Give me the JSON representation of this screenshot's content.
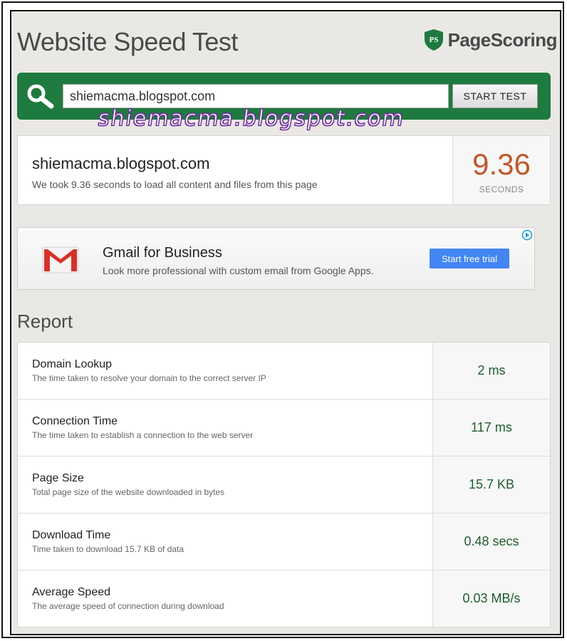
{
  "header": {
    "title": "Website Speed Test",
    "brand": "PageScoring",
    "brand_badge": "PS"
  },
  "search": {
    "value": "shiemacma.blogspot.com",
    "button_label": "START TEST"
  },
  "watermark": "shiemacma.blogspot.com",
  "result": {
    "domain": "shiemacma.blogspot.com",
    "description": "We took 9.36 seconds to load all content and files from this page",
    "score": "9.36",
    "unit": "SECONDS"
  },
  "ad": {
    "title": "Gmail for Business",
    "description": "Look more professional with custom email from Google Apps.",
    "button_label": "Start free trial"
  },
  "report": {
    "heading": "Report",
    "rows": [
      {
        "label": "Domain Lookup",
        "description": "The time taken to resolve your domain to the correct server IP",
        "value": "2 ms"
      },
      {
        "label": "Connection Time",
        "description": "The time taken to establish a connection to the web server",
        "value": "117 ms"
      },
      {
        "label": "Page Size",
        "description": "Total page size of the website downloaded in bytes",
        "value": "15.7 KB"
      },
      {
        "label": "Download Time",
        "description": "Time taken to download 15.7 KB of data",
        "value": "0.48 secs"
      },
      {
        "label": "Average Speed",
        "description": "The average speed of connection during download",
        "value": "0.03 MB/s"
      }
    ]
  },
  "colors": {
    "search_bar": "#1e7a3e",
    "score": "#c4572a",
    "value_text": "#1e5e2e",
    "ad_button": "#4285f4"
  }
}
